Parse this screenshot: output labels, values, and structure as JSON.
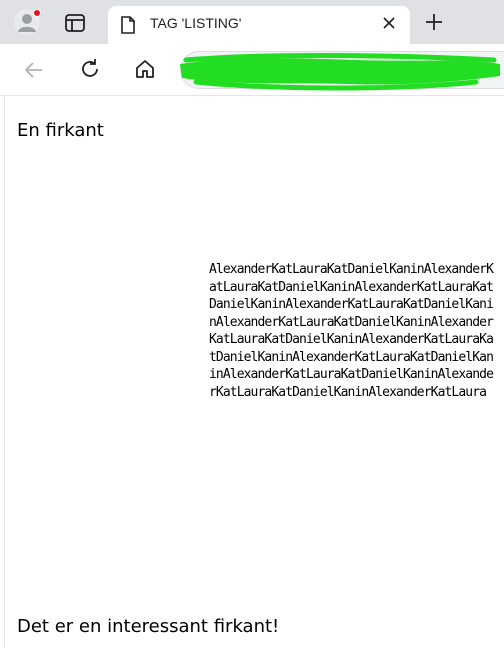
{
  "browser": {
    "tab": {
      "title": "TAG 'LISTING'"
    },
    "address_bar": {
      "url": ""
    },
    "colors": {
      "tab_strip": "#dfe1e5",
      "notification_dot": "#e81123",
      "redaction": "#22dd22"
    }
  },
  "page": {
    "heading": "En firkant",
    "listing_text": "AlexanderKatLauraKatDanielKaninAlexanderKatLauraKatDanielKaninAlexanderKatLauraKatDanielKaninAlexanderKatLauraKatDanielKaninAlexanderKatLauraKatDanielKaninAlexanderKatLauraKatDanielKaninAlexanderKatLauraKatDanielKaninAlexanderKatLauraKatDanielKaninAlexanderKatLauraKatDanielKaninAlexanderKatLauraKatDanielKaninAlexanderKatLaura",
    "footer_text": "Det er en interessant firkant!"
  }
}
